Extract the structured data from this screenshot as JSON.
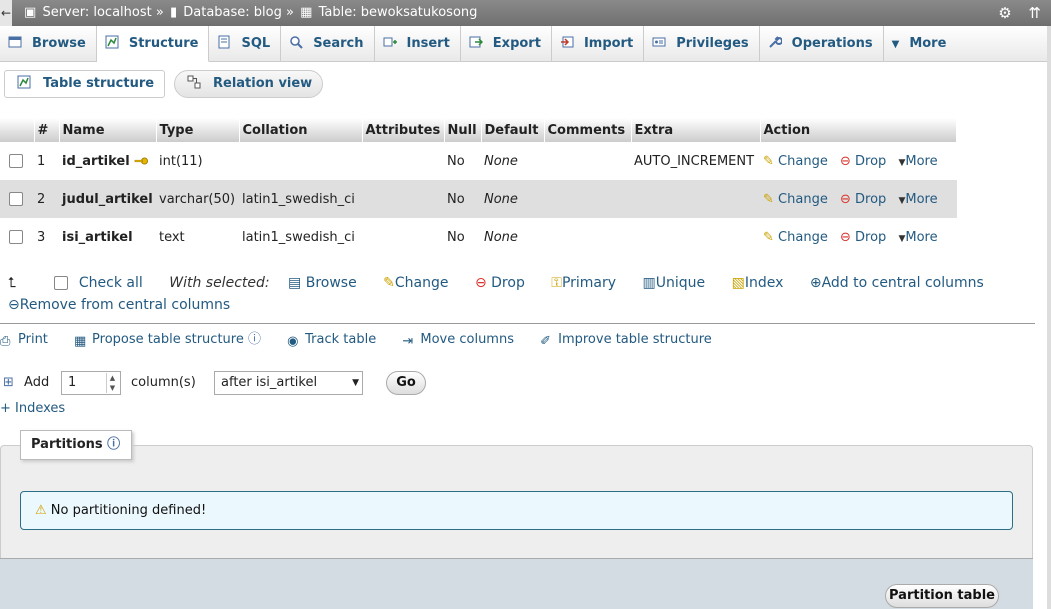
{
  "breadcrumb": {
    "server": "Server: localhost",
    "sep1": "»",
    "database": "Database: blog",
    "sep2": "»",
    "table": "Table: bewoksatukosong"
  },
  "tabs": [
    {
      "label": "Browse",
      "icon": "browse-icon"
    },
    {
      "label": "Structure",
      "icon": "structure-icon",
      "active": true
    },
    {
      "label": "SQL",
      "icon": "sql-icon"
    },
    {
      "label": "Search",
      "icon": "search-icon"
    },
    {
      "label": "Insert",
      "icon": "insert-icon"
    },
    {
      "label": "Export",
      "icon": "export-icon"
    },
    {
      "label": "Import",
      "icon": "import-icon"
    },
    {
      "label": "Privileges",
      "icon": "privileges-icon"
    },
    {
      "label": "Operations",
      "icon": "operations-icon"
    },
    {
      "label": "More",
      "icon": "chevron-down-icon"
    }
  ],
  "subtabs": {
    "table_structure": "Table structure",
    "relation_view": "Relation view"
  },
  "columns_header": [
    "#",
    "Name",
    "Type",
    "Collation",
    "Attributes",
    "Null",
    "Default",
    "Comments",
    "Extra",
    "Action"
  ],
  "rows": [
    {
      "num": "1",
      "name": "id_artikel",
      "type": "int(11)",
      "collation": "",
      "attributes": "",
      "null": "No",
      "default": "None",
      "comments": "",
      "extra": "AUTO_INCREMENT",
      "primary": true
    },
    {
      "num": "2",
      "name": "judul_artikel",
      "type": "varchar(50)",
      "collation": "latin1_swedish_ci",
      "attributes": "",
      "null": "No",
      "default": "None",
      "comments": "",
      "extra": ""
    },
    {
      "num": "3",
      "name": "isi_artikel",
      "type": "text",
      "collation": "latin1_swedish_ci",
      "attributes": "",
      "null": "No",
      "default": "None",
      "comments": "",
      "extra": ""
    }
  ],
  "row_actions": {
    "change": "Change",
    "drop": "Drop",
    "more": "More"
  },
  "with_selected": {
    "check_all": "Check all",
    "label": "With selected:",
    "browse": "Browse",
    "change": "Change",
    "drop": "Drop",
    "primary": "Primary",
    "unique": "Unique",
    "index": "Index",
    "add_central": "Add to central columns",
    "remove_central": "Remove from central columns"
  },
  "tools": {
    "print": "Print",
    "propose": "Propose table structure",
    "track": "Track table",
    "move": "Move columns",
    "improve": "Improve table structure"
  },
  "add_columns": {
    "add_label": "Add",
    "count": "1",
    "columns_label": "column(s)",
    "position": "after isi_artikel",
    "go": "Go"
  },
  "indexes_link": "+ Indexes",
  "partitions": {
    "legend": "Partitions",
    "notice": "No partitioning defined!",
    "partition_button": "Partition table"
  },
  "colors": {
    "link": "#235a81",
    "notice_bg": "#ebf8fd",
    "notice_border": "#2a6f86",
    "drop_red": "#d9322b"
  }
}
